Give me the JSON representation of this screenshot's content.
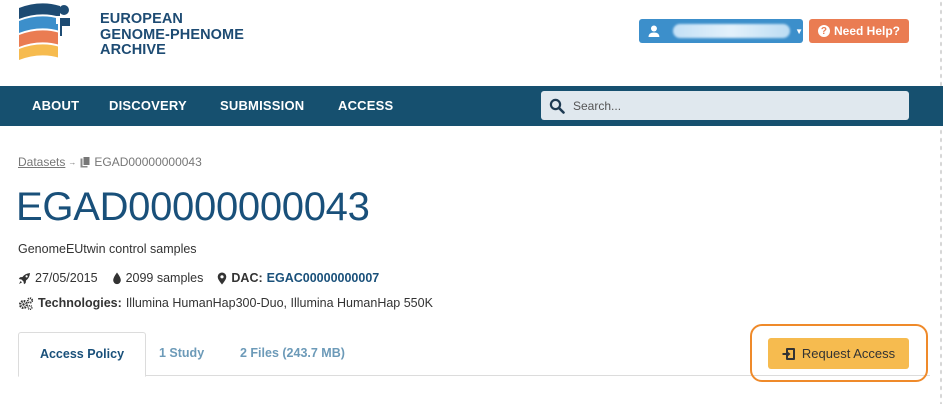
{
  "logo": {
    "line1": "EUROPEAN",
    "line2": "GENOME-PHENOME",
    "line3": "ARCHIVE",
    "colors": {
      "navy": "#1d4b73",
      "blue": "#3c8fcb",
      "orange": "#ea7c52",
      "yellow": "#f6bb4f"
    }
  },
  "header": {
    "user_icon": "user-icon",
    "help_label": "Need Help?",
    "help_icon": "question-circle-icon"
  },
  "nav": {
    "items": [
      {
        "label": "ABOUT"
      },
      {
        "label": "DISCOVERY"
      },
      {
        "label": "SUBMISSION"
      },
      {
        "label": "ACCESS"
      }
    ],
    "search_placeholder": "Search..."
  },
  "breadcrumb": {
    "link": "Datasets",
    "current": "EGAD00000000043"
  },
  "dataset": {
    "title": "EGAD00000000043",
    "description": "GenomeEUtwin control samples",
    "date": "27/05/2015",
    "samples": "2099 samples",
    "dac_label": "DAC:",
    "dac_value": "EGAC00000000007",
    "technologies_label": "Technologies:",
    "technologies_value": "Illumina HumanHap300-Duo, Illumina HumanHap 550K"
  },
  "tabs": [
    {
      "label": "Access Policy",
      "active": true
    },
    {
      "label": "1 Study",
      "active": false
    },
    {
      "label": "2 Files (243.7 MB)",
      "active": false
    }
  ],
  "request_access": {
    "label": "Request Access",
    "icon": "sign-in-icon"
  },
  "colors": {
    "nav_bg": "#16506f",
    "link": "#19507a",
    "tab_inactive": "#6c9ab8",
    "request_bg": "#f6bb4f",
    "highlight_ring": "#ef8a2a"
  }
}
